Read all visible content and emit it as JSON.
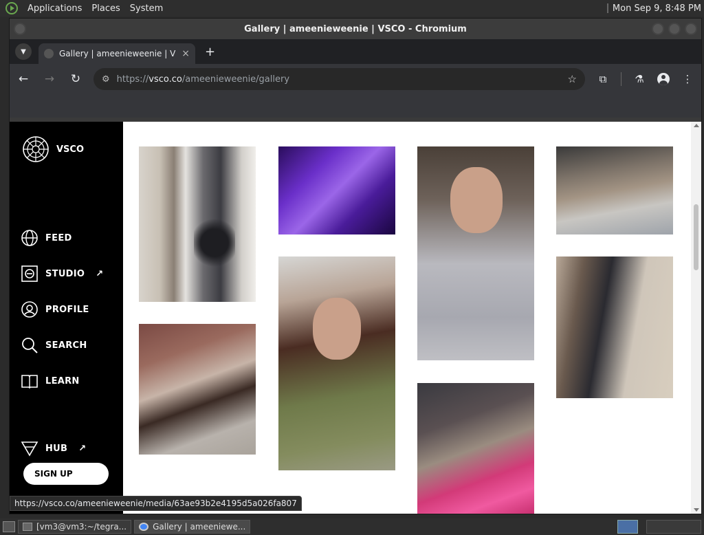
{
  "os": {
    "menu": [
      "Applications",
      "Places",
      "System"
    ],
    "clock": "Mon Sep  9,  8:48 PM"
  },
  "window": {
    "title": "Gallery | ameenieweenie | VSCO - Chromium"
  },
  "tab": {
    "title": "Gallery | ameenieweenie | VSCO",
    "close": "×",
    "new_tab": "+"
  },
  "toolbar": {
    "back": "←",
    "forward": "→",
    "reload": "↻",
    "url_prefix": "https://",
    "url_host": "vsco.co",
    "url_path": "/ameenieweenie/gallery",
    "star": "☆",
    "extensions": "⧉",
    "labs": "⚗",
    "menu": "⋮"
  },
  "sidebar": {
    "brand": "VSCO",
    "items": [
      {
        "label": "FEED",
        "icon": "globe-icon",
        "external": false
      },
      {
        "label": "STUDIO",
        "icon": "studio-icon",
        "external": true
      },
      {
        "label": "PROFILE",
        "icon": "profile-icon",
        "external": false
      },
      {
        "label": "SEARCH",
        "icon": "search-icon",
        "external": false
      },
      {
        "label": "LEARN",
        "icon": "book-icon",
        "external": false
      },
      {
        "label": "HUB",
        "icon": "hub-icon",
        "external": true
      }
    ],
    "external_arrow": "↗",
    "signup": "SIGN UP"
  },
  "status_url": "https://vsco.co/ameenieweenie/media/63ae93b2e4195d5a026fa807",
  "taskbar": {
    "items": [
      {
        "label": "[vm3@vm3:~/tegra...",
        "icon": "terminal-icon"
      },
      {
        "label": "Gallery | ameeniewe...",
        "icon": "chromium-icon"
      }
    ]
  },
  "colors": {
    "sidebar_bg": "#000000",
    "page_bg": "#ffffff",
    "chrome_toolbar": "#35363a",
    "chrome_tabstrip": "#202124"
  }
}
